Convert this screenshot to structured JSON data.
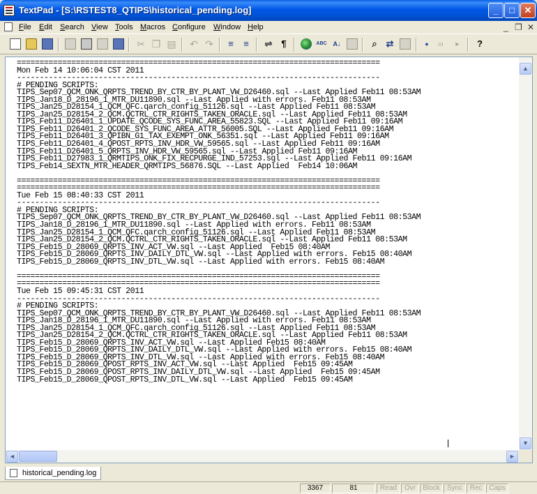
{
  "window": {
    "title": "TextPad - [S:\\RSTEST8_QTIPS\\historical_pending.log]",
    "minimize": "_",
    "maximize": "□",
    "close": "✕"
  },
  "menu": [
    {
      "label": "File"
    },
    {
      "label": "Edit"
    },
    {
      "label": "Search"
    },
    {
      "label": "View"
    },
    {
      "label": "Tools"
    },
    {
      "label": "Macros"
    },
    {
      "label": "Configure"
    },
    {
      "label": "Window"
    },
    {
      "label": "Help"
    }
  ],
  "mdi_controls": {
    "minimize": "_",
    "restore": "❐",
    "close": "✕"
  },
  "toolbar_icons": [
    "new-file-icon",
    "open-file-icon",
    "save-icon",
    "document-properties-icon",
    "print-icon",
    "print-preview-icon",
    "workspace-icon",
    "cut-icon",
    "copy-icon",
    "paste-icon",
    "undo-icon",
    "redo-icon",
    "indent-icon",
    "unindent-icon",
    "word-wrap-icon",
    "pilcrow-icon",
    "web-browser-icon",
    "spelling-icon",
    "sort-icon",
    "compare-icon",
    "find-icon",
    "replace-icon",
    "find-in-files-icon",
    "record-macro-icon",
    "play-macro-icon",
    "next-icon",
    "context-help-icon"
  ],
  "toolbar_glyphs": {
    "pilcrow": "¶",
    "spell": "ABC",
    "sort": "A↓",
    "play": "►",
    "help": "?"
  },
  "editor": {
    "lines": [
      "================================================================================",
      "Mon Feb 14 10:06:04 CST 2011",
      "--------------------------------------------------------------------------------",
      "# PENDING SCRIPTS:",
      "TIPS_Sep07_QCM_ONK_QRPTS_TREND_BY_CTR_BY_PLANT_VW_D26460.sql --Last Applied Feb11 08:53AM",
      "TIPS_Jan18_D_28196_1_MTR_DU11890.sql --Last Applied with errors. Feb11 08:53AM",
      "TIPS_Jan25_D28154_1_QCM_QFC.qarch_config_51126.sql --Last Applied Feb11 08:53AM",
      "TIPS_Jan25_D28154_2_QCM.QCTRL_CTR_RIGHTS_TAKEN_ORACLE.sql --Last Applied Feb11 08:53AM",
      "TIPS_Feb11_D26401_1_UPDATE_QCODE_SYS_FUNC_AREA_55823.SQL --Last Applied Feb11 09:16AM",
      "TIPS_Feb11_D26401_2_QCODE_SYS_FUNC_AREA_ATTR_56005.SQL --Last Applied Feb11 09:16AM",
      "TIPS_Feb11_D26401_3_QPIBN_G1_TAX_EXEMPT_ONK_56351.sql --Last Applied Feb11 09:16AM",
      "TIPS_Feb11_D26401_4_QPOST_RPTS_INV_HDR_VW_59565.sql --Last Applied Feb11 09:16AM",
      "TIPS_Feb11_D26401_5_QRPTS_INV_HDR_VW_59565.sql --Last Applied Feb11 09:16AM",
      "TIPS_Feb11_D27983_1_QRMTIPS_ONK_FIX_RECPURGE_IND_57253.sql --Last Applied Feb11 09:16AM",
      "TIPS_Feb14_SEXTN_MTR_HEADER_QRMTIPS_56876.SQL --Last Applied  Feb14 10:06AM",
      "",
      "================================================================================",
      "================================================================================",
      "Tue Feb 15 08:40:33 CST 2011",
      "--------------------------------------------------------------------------------",
      "# PENDING SCRIPTS:",
      "TIPS_Sep07_QCM_ONK_QRPTS_TREND_BY_CTR_BY_PLANT_VW_D26460.sql --Last Applied Feb11 08:53AM",
      "TIPS_Jan18_D_28196_1_MTR_DU11890.sql --Last Applied with errors. Feb11 08:53AM",
      "TIPS_Jan25_D28154_1_QCM_QFC.qarch_config_51126.sql --Last Applied Feb11 08:53AM",
      "TIPS_Jan25_D28154_2_QCM.QCTRL_CTR_RIGHTS_TAKEN_ORACLE.sql --Last Applied Feb11 08:53AM",
      "TIPS_Feb15_D_28069_QRPTS_INV_ACT_VW.sql --Last Applied  Feb15 08:40AM",
      "TIPS_Feb15_D_28069_QRPTS_INV_DAILY_DTL_VW.sql --Last Applied with errors. Feb15 08:40AM",
      "TIPS_Feb15_D_28069_QRPTS_INV_DTL_VW.sql --Last Applied with errors. Feb15 08:40AM",
      "",
      "================================================================================",
      "================================================================================",
      "Tue Feb 15 09:45:31 CST 2011",
      "--------------------------------------------------------------------------------",
      "# PENDING SCRIPTS:",
      "TIPS_Sep07_QCM_ONK_QRPTS_TREND_BY_CTR_BY_PLANT_VW_D26460.sql --Last Applied Feb11 08:53AM",
      "TIPS_Jan18_D_28196_1_MTR_DU11890.sql --Last Applied with errors. Feb11 08:53AM",
      "TIPS_Jan25_D28154_1_QCM_QFC.qarch_config_51126.sql --Last Applied Feb11 08:53AM",
      "TIPS_Jan25_D28154_2_QCM.QCTRL_CTR_RIGHTS_TAKEN_ORACLE.sql --Last Applied Feb11 08:53AM",
      "TIPS_Feb15_D_28069_QRPTS_INV_ACT_VW.sql --Last Applied Feb15 08:40AM",
      "TIPS_Feb15_D_28069_QRPTS_INV_DAILY_DTL_VW.sql --Last Applied with errors. Feb15 08:40AM",
      "TIPS_Feb15_D_28069_QRPTS_INV_DTL_VW.sql --Last Applied with errors. Feb15 08:40AM",
      "TIPS_Feb15_D_28069_QPOST_RPTS_INV_ACT_VW.sql --Last Applied  Feb15 09:45AM",
      "TIPS_Feb15_D_28069_QPOST_RPTS_INV_DAILY_DTL_VW.sql --Last Applied  Feb15 09:45AM",
      "TIPS_Feb15_D_28069_QPOST_RPTS_INV_DTL_VW.sql --Last Applied  Feb15 09:45AM"
    ]
  },
  "scrollbars": {
    "up": "▲",
    "down": "▼",
    "left": "◄",
    "right": "►"
  },
  "document_tab": {
    "label": "historical_pending.log"
  },
  "status": {
    "line": "3367",
    "column": "81",
    "read": "Read",
    "ovr": "Ovr",
    "block": "Block",
    "sync": "Sync",
    "rec": "Rec",
    "caps": "Caps"
  }
}
